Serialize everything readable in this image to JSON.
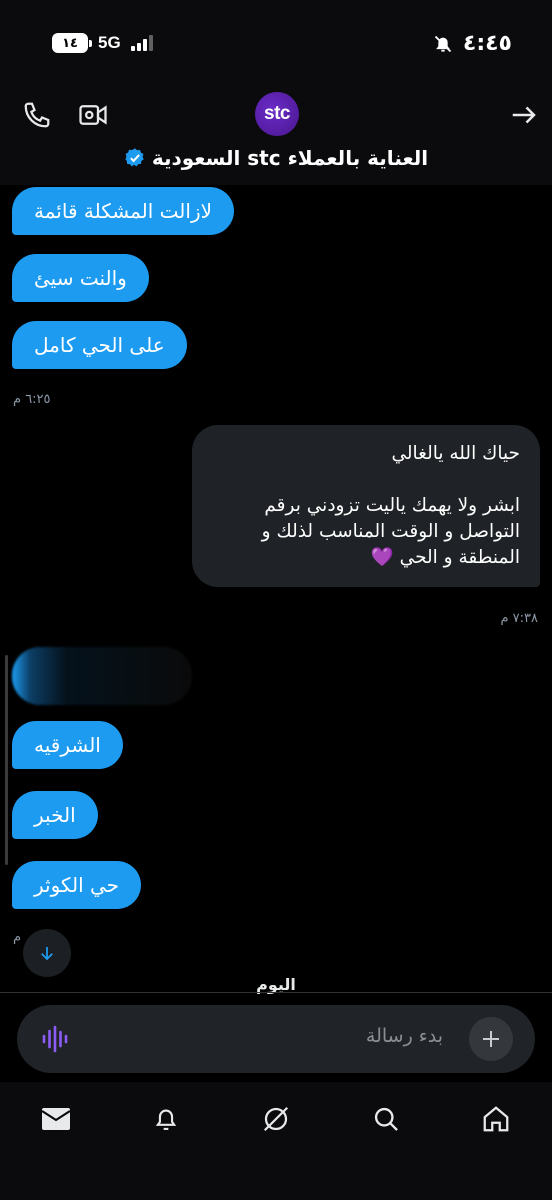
{
  "status_bar": {
    "battery": "١٤",
    "network": "5G",
    "time": "٤:٤٥"
  },
  "header": {
    "avatar_text": "stc",
    "title": "العناية بالعملاء stc السعودية"
  },
  "messages": {
    "in1": "لازالت المشكلة قائمة",
    "in2": "والنت سيئ",
    "in3": "على الحي كامل",
    "time1": "٦:٢٥ م",
    "out_line1": "حياك الله يالغالي",
    "out_line2": "ابشر ولا يهمك ياليت تزودني برقم التواصل و الوقت المناسب لذلك و المنطقة و الحي 💜",
    "time2": "٧:٣٨ م",
    "in4": "الشرقيه",
    "in5": "الخبر",
    "in6": "حي الكوثر",
    "time3": "م",
    "today": "اليوم"
  },
  "composer": {
    "placeholder": "بدء رسالة"
  },
  "colors": {
    "accent": "#1d9bf0",
    "brand": "#4f1a9c",
    "voice": "#8b5cf6",
    "out_bubble": "#1f2327"
  }
}
